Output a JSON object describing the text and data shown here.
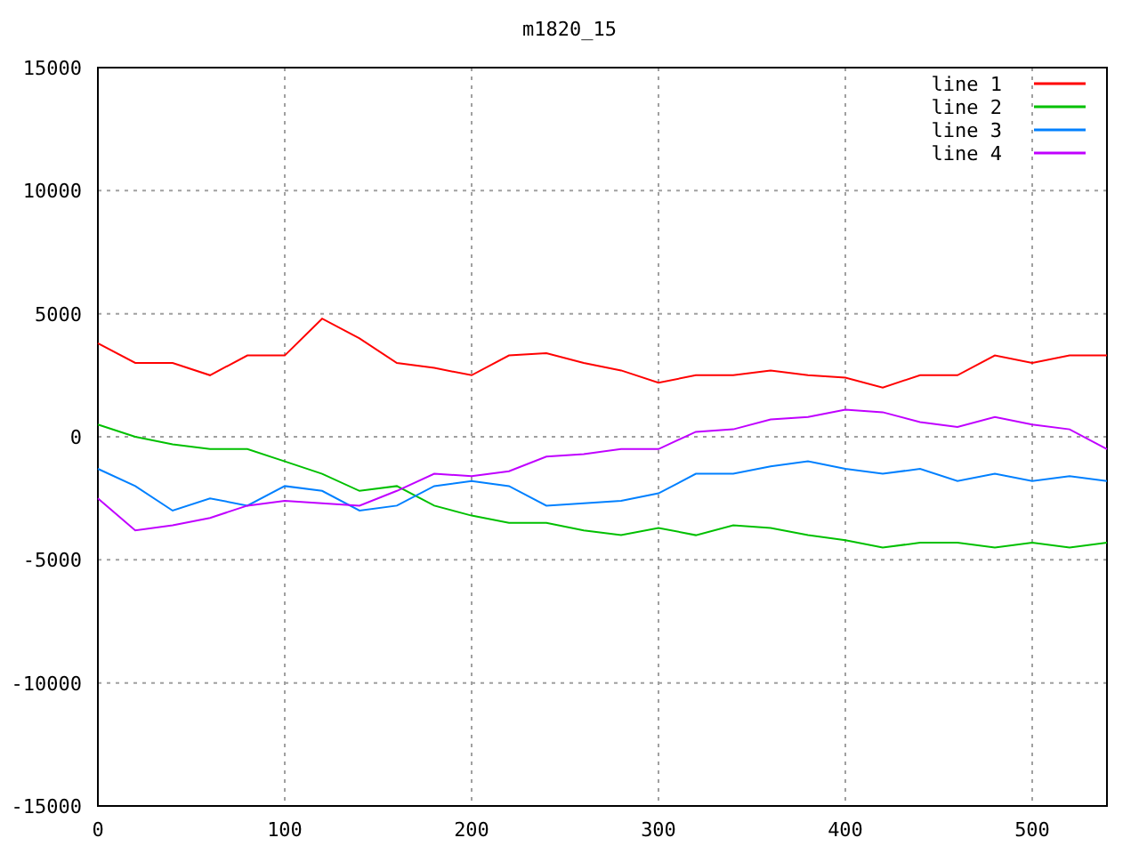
{
  "chart_data": {
    "type": "line",
    "title": "m1820_15",
    "x": [
      0,
      20,
      40,
      60,
      80,
      100,
      120,
      140,
      160,
      180,
      200,
      220,
      240,
      260,
      280,
      300,
      320,
      340,
      360,
      380,
      400,
      420,
      440,
      460,
      480,
      500,
      520,
      540
    ],
    "grid": true,
    "legend": true,
    "xlim": [
      0,
      540
    ],
    "ylim": [
      -15000,
      15000
    ],
    "xticks": [
      0,
      100,
      200,
      300,
      400,
      500
    ],
    "yticks": [
      -15000,
      -10000,
      -5000,
      0,
      5000,
      10000,
      15000
    ],
    "series": [
      {
        "name": "line 1",
        "color": "#ff0000",
        "values": [
          3800,
          3000,
          3000,
          2500,
          3300,
          3300,
          4800,
          4000,
          3000,
          2800,
          2500,
          3300,
          3400,
          3000,
          2700,
          2200,
          2500,
          2500,
          2700,
          2500,
          2400,
          2000,
          2500,
          2500,
          3300,
          3000,
          3300,
          3300
        ]
      },
      {
        "name": "line 2",
        "color": "#00c000",
        "values": [
          500,
          0,
          -300,
          -500,
          -500,
          -1000,
          -1500,
          -2200,
          -2000,
          -2800,
          -3200,
          -3500,
          -3500,
          -3800,
          -4000,
          -3700,
          -4000,
          -3600,
          -3700,
          -4000,
          -4200,
          -4500,
          -4300,
          -4300,
          -4500,
          -4300,
          -4500,
          -4300
        ]
      },
      {
        "name": "line 3",
        "color": "#0080ff",
        "values": [
          -1300,
          -2000,
          -3000,
          -2500,
          -2800,
          -2000,
          -2200,
          -3000,
          -2800,
          -2000,
          -1800,
          -2000,
          -2800,
          -2700,
          -2600,
          -2300,
          -1500,
          -1500,
          -1200,
          -1000,
          -1300,
          -1500,
          -1300,
          -1800,
          -1500,
          -1800,
          -1600,
          -1800
        ]
      },
      {
        "name": "line 4",
        "color": "#c000ff",
        "values": [
          -2500,
          -3800,
          -3600,
          -3300,
          -2800,
          -2600,
          -2700,
          -2800,
          -2200,
          -1500,
          -1600,
          -1400,
          -800,
          -700,
          -500,
          -500,
          200,
          300,
          700,
          800,
          1100,
          1000,
          600,
          400,
          800,
          500,
          300,
          -500
        ]
      }
    ]
  }
}
